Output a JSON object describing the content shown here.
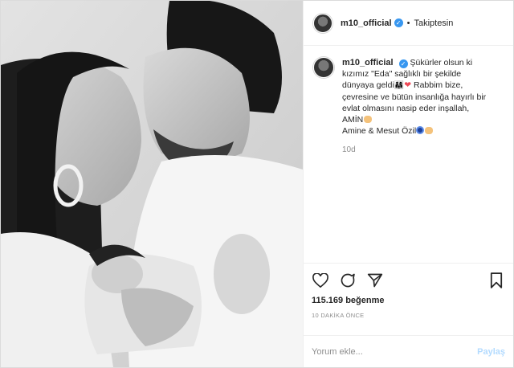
{
  "post": {
    "username": "m10_official",
    "verified_icon": "verified-badge-icon",
    "separator": "•",
    "follow_status": "Takiptesin",
    "caption": {
      "username": "m10_official",
      "line1": "Şükürler olsun ki",
      "line2": "kızımız \"Eda\" sağlıklı bir şekilde",
      "line3": "dünyaya geldi",
      "line3b": " Rabbim bize,",
      "line4": "çevresine ve bütün insanlığa hayırlı bir",
      "line5": "evlat olmasını nasip eder inşallah,",
      "line6": "AMİN",
      "line7": "Amine & Mesut Özil"
    },
    "time_ago": "10d",
    "likes": "115.169 beğenme",
    "timestamp": "10 DAKİKA ÖNCE",
    "comment_placeholder": "Yorum ekle...",
    "post_button": "Paylaş",
    "colors": {
      "accent": "#3897f0",
      "heart": "#ed4956",
      "muted": "#8e8e8e",
      "post_disabled": "#b3dbff"
    },
    "icons": [
      "heart-outline-icon",
      "comment-icon",
      "share-icon",
      "bookmark-icon"
    ]
  }
}
